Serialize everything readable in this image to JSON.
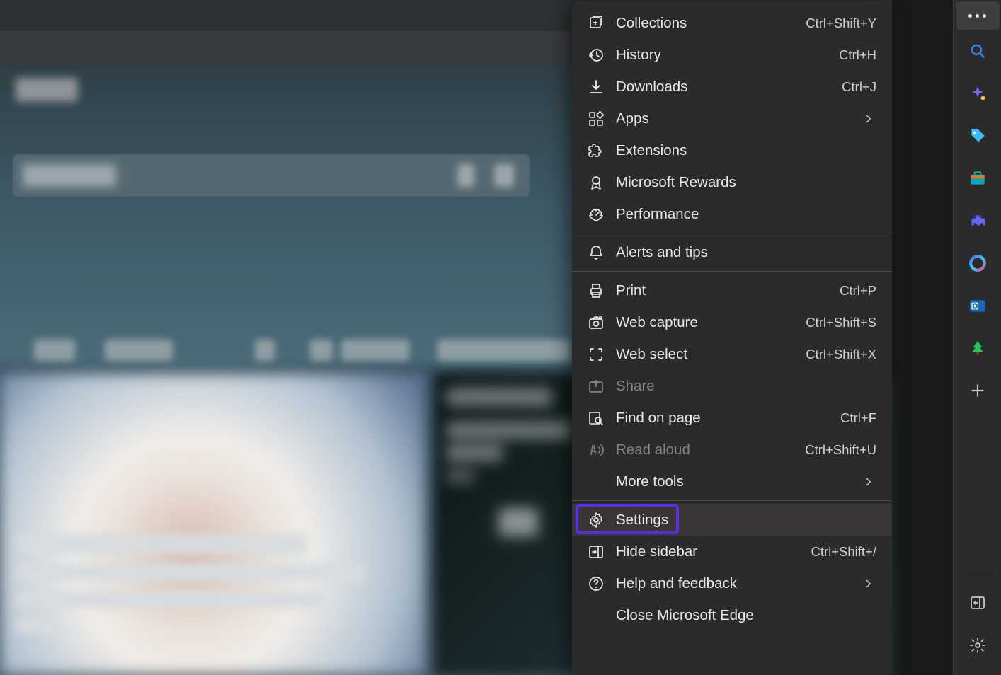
{
  "menu": {
    "items": [
      {
        "icon": "collections-icon",
        "label": "Collections",
        "shortcut": "Ctrl+Shift+Y",
        "hasSubmenu": false,
        "disabled": false
      },
      {
        "icon": "history-icon",
        "label": "History",
        "shortcut": "Ctrl+H",
        "hasSubmenu": false,
        "disabled": false
      },
      {
        "icon": "downloads-icon",
        "label": "Downloads",
        "shortcut": "Ctrl+J",
        "hasSubmenu": false,
        "disabled": false
      },
      {
        "icon": "apps-icon",
        "label": "Apps",
        "shortcut": "",
        "hasSubmenu": true,
        "disabled": false
      },
      {
        "icon": "extensions-icon",
        "label": "Extensions",
        "shortcut": "",
        "hasSubmenu": false,
        "disabled": false
      },
      {
        "icon": "rewards-icon",
        "label": "Microsoft Rewards",
        "shortcut": "",
        "hasSubmenu": false,
        "disabled": false
      },
      {
        "icon": "performance-icon",
        "label": "Performance",
        "shortcut": "",
        "hasSubmenu": false,
        "disabled": false
      }
    ],
    "items2": [
      {
        "icon": "bell-icon",
        "label": "Alerts and tips",
        "shortcut": "",
        "hasSubmenu": false,
        "disabled": false
      }
    ],
    "items3": [
      {
        "icon": "print-icon",
        "label": "Print",
        "shortcut": "Ctrl+P",
        "hasSubmenu": false,
        "disabled": false
      },
      {
        "icon": "webcapture-icon",
        "label": "Web capture",
        "shortcut": "Ctrl+Shift+S",
        "hasSubmenu": false,
        "disabled": false
      },
      {
        "icon": "webselect-icon",
        "label": "Web select",
        "shortcut": "Ctrl+Shift+X",
        "hasSubmenu": false,
        "disabled": false
      },
      {
        "icon": "share-icon",
        "label": "Share",
        "shortcut": "",
        "hasSubmenu": false,
        "disabled": true
      },
      {
        "icon": "find-icon",
        "label": "Find on page",
        "shortcut": "Ctrl+F",
        "hasSubmenu": false,
        "disabled": false
      },
      {
        "icon": "readaloud-icon",
        "label": "Read aloud",
        "shortcut": "Ctrl+Shift+U",
        "hasSubmenu": false,
        "disabled": true
      },
      {
        "icon": "",
        "label": "More tools",
        "shortcut": "",
        "hasSubmenu": true,
        "disabled": false
      }
    ],
    "items4": [
      {
        "icon": "settings-icon",
        "label": "Settings",
        "shortcut": "",
        "hasSubmenu": false,
        "disabled": false,
        "hovered": true,
        "highlight": true
      },
      {
        "icon": "hidesidebar-icon",
        "label": "Hide sidebar",
        "shortcut": "Ctrl+Shift+/",
        "hasSubmenu": false,
        "disabled": false
      },
      {
        "icon": "help-icon",
        "label": "Help and feedback",
        "shortcut": "",
        "hasSubmenu": true,
        "disabled": false
      },
      {
        "icon": "",
        "label": "Close Microsoft Edge",
        "shortcut": "",
        "hasSubmenu": false,
        "disabled": false
      }
    ]
  },
  "sidebar": {
    "items": [
      {
        "name": "search-icon"
      },
      {
        "name": "ai-sparkle-icon"
      },
      {
        "name": "shopping-tag-icon"
      },
      {
        "name": "toolbox-icon"
      },
      {
        "name": "games-icon"
      },
      {
        "name": "office-icon"
      },
      {
        "name": "outlook-icon"
      },
      {
        "name": "tree-icon"
      },
      {
        "name": "plus-icon"
      }
    ],
    "bottom": [
      {
        "name": "collapse-sidebar-icon"
      },
      {
        "name": "gear-icon"
      }
    ]
  }
}
